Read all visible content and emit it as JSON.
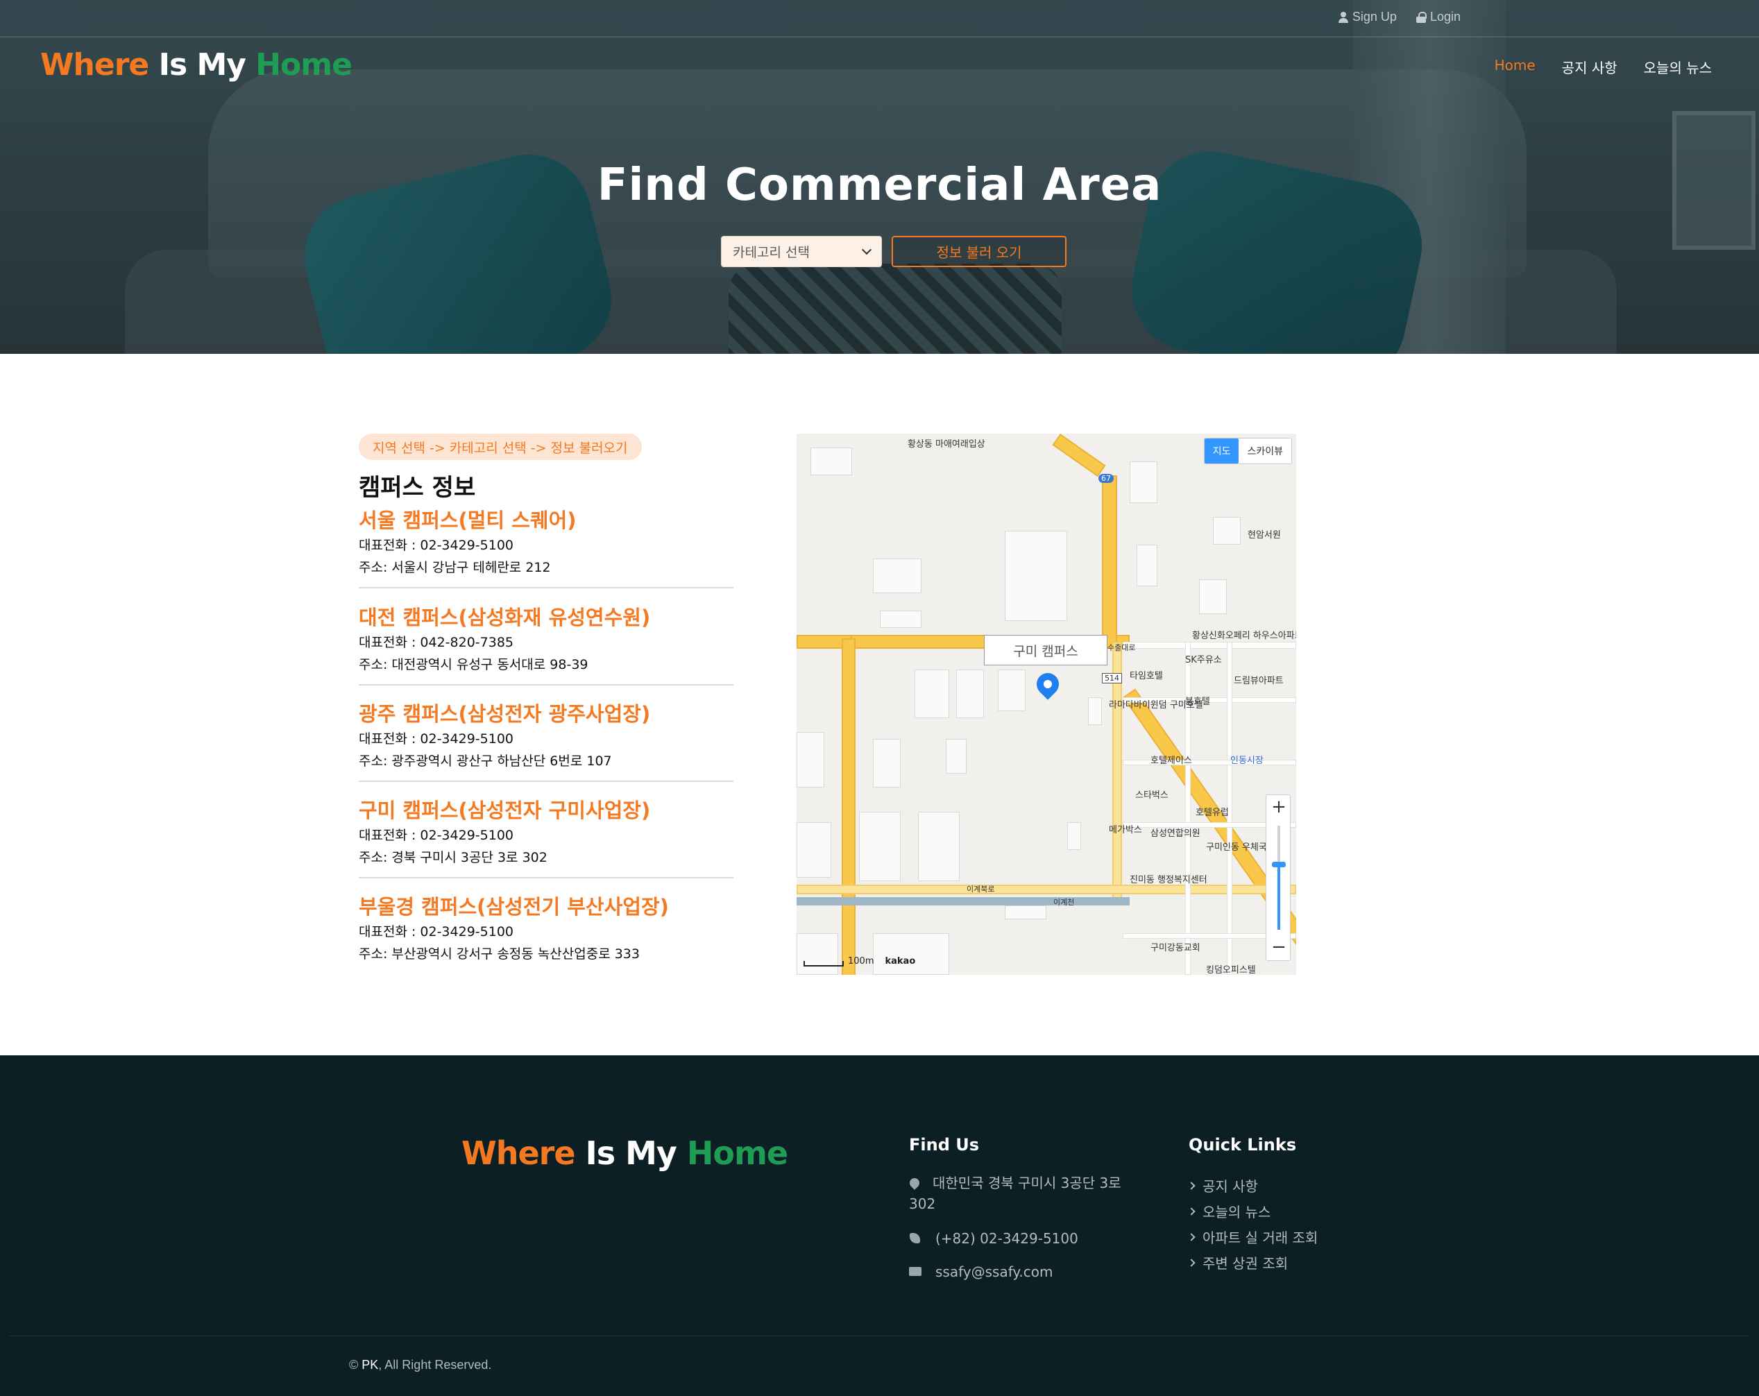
{
  "topbar": {
    "signup": "Sign Up",
    "login": "Login"
  },
  "brand": {
    "w": "Where",
    "is": " Is My ",
    "h": "Home"
  },
  "nav": [
    "Home",
    "공지 사항",
    "오늘의 뉴스"
  ],
  "hero": {
    "title": "Find Commercial Area",
    "select_value": "카테고리 선택",
    "button": "정보 불러 오기"
  },
  "main": {
    "pill": "지역 선택 -> 카테고리 선택 -> 정보 불러오기",
    "section_title": "캠퍼스 정보",
    "campuses": [
      {
        "name": "서울 캠퍼스(멀티 스퀘어)",
        "phone": "대표전화 : 02-3429-5100",
        "address": "주소: 서울시 강남구 테헤란로 212"
      },
      {
        "name": "대전 캠퍼스(삼성화재 유성연수원)",
        "phone": "대표전화 : 042-820-7385",
        "address": "주소: 대전광역시 유성구 동서대로 98-39"
      },
      {
        "name": "광주 캠퍼스(삼성전자 광주사업장)",
        "phone": "대표전화 : 02-3429-5100",
        "address": "주소: 광주광역시 광산구 하남산단 6번로 107"
      },
      {
        "name": "구미 캠퍼스(삼성전자 구미사업장)",
        "phone": "대표전화 : 02-3429-5100",
        "address": "주소: 경북 구미시 3공단 3로 302"
      },
      {
        "name": "부울경 캠퍼스(삼성전기 부산사업장)",
        "phone": "대표전화 : 02-3429-5100",
        "address": "주소: 부산광역시 강서구 송정동 녹산산업중로 333"
      }
    ]
  },
  "map": {
    "type_map": "지도",
    "type_sky": "스카이뷰",
    "info_window": "구미 캠퍼스",
    "scale": "100m",
    "provider": "kakao",
    "zoom_plus": "+",
    "zoom_minus": "−",
    "labels": [
      "황상동 마애여래입상",
      "현암서원",
      "황상신화오페리 하우스아파트",
      "SK주유소",
      "타임호텔",
      "드림뷰아파트",
      "라마다바이윈덤 구미호텔",
      "붐호텔",
      "호텔제이스",
      "인동시장",
      "스타벅스",
      "호텔유럽",
      "메가박스",
      "삼성연합의원",
      "구미인동 우체국",
      "진미동 행정복지센터",
      "구미강동교회",
      "킹덤오피스텔",
      "이계북로",
      "이계천",
      "수출대로",
      "67",
      "514"
    ]
  },
  "footer": {
    "find_us_title": "Find Us",
    "address": "대한민국 경북 구미시 3공단 3로 302",
    "phone": "(+82) 02-3429-5100",
    "email": "ssafy@ssafy.com",
    "quick_links_title": "Quick Links",
    "quick_links": [
      "공지 사항",
      "오늘의 뉴스",
      "아파트 실 거래 조회",
      "주변 상권 조회"
    ],
    "copyright_symbol": "©",
    "copyright_name": "PK",
    "copyright_rest": ", All Right Reserved."
  },
  "colors": {
    "accent": "#f47920",
    "brand_green": "#1f9d55",
    "footer_bg": "#0c1f24",
    "map_button": "#3396ff"
  }
}
